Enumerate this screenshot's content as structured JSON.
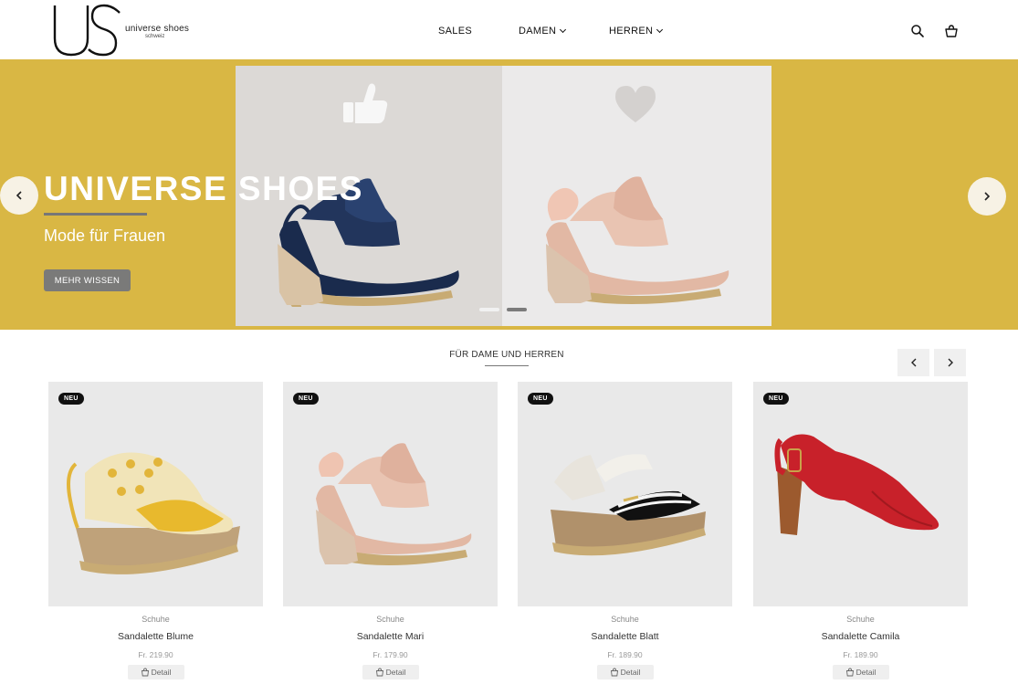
{
  "header": {
    "logo": {
      "mark": "US",
      "brand": "universe shoes",
      "sub": "schweiz"
    },
    "nav": [
      {
        "label": "SALES"
      },
      {
        "label": "DAMEN"
      },
      {
        "label": "HERREN"
      }
    ],
    "icons": [
      "search-icon",
      "cart-icon"
    ]
  },
  "hero": {
    "title": "UNIVERSE SHOES",
    "subtitle": "Mode für Frauen",
    "button_label": "MEHR WISSEN",
    "background_color": "#d9b744",
    "slides_count": 2,
    "active_slide": 2
  },
  "section": {
    "title": "FÜR DAME UND HERREN"
  },
  "products": [
    {
      "badge": "NEU",
      "category": "Schuhe",
      "name": "Sandalette Blume",
      "price": "Fr. 219.90",
      "detail_label": "Detail"
    },
    {
      "badge": "NEU",
      "category": "Schuhe",
      "name": "Sandalette Mari",
      "price": "Fr. 179.90",
      "detail_label": "Detail"
    },
    {
      "badge": "NEU",
      "category": "Schuhe",
      "name": "Sandalette Blatt",
      "price": "Fr. 189.90",
      "detail_label": "Detail"
    },
    {
      "badge": "NEU",
      "category": "Schuhe",
      "name": "Sandalette Camila",
      "price": "Fr. 189.90",
      "detail_label": "Detail"
    }
  ]
}
